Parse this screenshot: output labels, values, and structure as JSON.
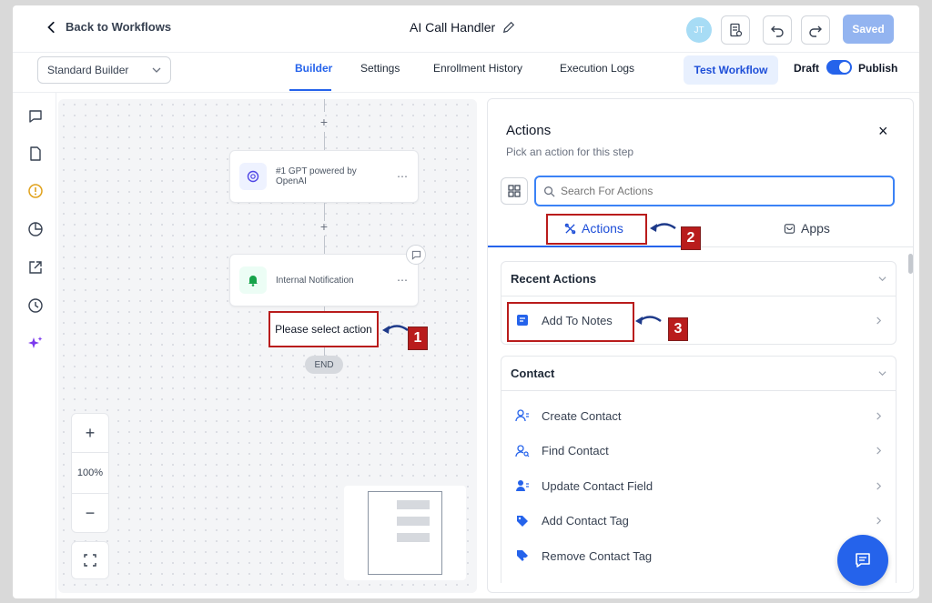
{
  "header": {
    "back_label": "Back to Workflows",
    "workflow_title": "AI Call Handler",
    "avatar_initials": "JT",
    "saved_label": "Saved"
  },
  "subbar": {
    "builder_mode": "Standard Builder",
    "tabs": [
      {
        "label": "Builder",
        "active": true
      },
      {
        "label": "Settings",
        "active": false
      },
      {
        "label": "Enrollment History",
        "active": false
      },
      {
        "label": "Execution Logs",
        "active": false
      }
    ],
    "test_label": "Test Workflow",
    "draft_label": "Draft",
    "publish_label": "Publish",
    "published": true
  },
  "canvas": {
    "nodes": [
      {
        "label": "#1 GPT powered by OpenAI",
        "icon": "openai-icon"
      },
      {
        "label": "Internal Notification",
        "icon": "bell-icon"
      }
    ],
    "select_action_label": "Please select action",
    "end_label": "END",
    "zoom_level": "100%",
    "plus_symbol": "+",
    "zoom_in_symbol": "+",
    "zoom_out_symbol": "−"
  },
  "callouts": [
    "1",
    "2",
    "3"
  ],
  "panel": {
    "title": "Actions",
    "subtitle": "Pick an action for this step",
    "close_symbol": "×",
    "search_placeholder": "Search For Actions",
    "tabs": [
      {
        "label": "Actions",
        "active": true
      },
      {
        "label": "Apps",
        "active": false
      }
    ],
    "sections": [
      {
        "title": "Recent Actions",
        "items": [
          {
            "label": "Add To Notes",
            "icon": "note-icon"
          }
        ]
      },
      {
        "title": "Contact",
        "items": [
          {
            "label": "Create Contact",
            "icon": "create-contact-icon"
          },
          {
            "label": "Find Contact",
            "icon": "find-contact-icon"
          },
          {
            "label": "Update Contact Field",
            "icon": "update-contact-icon"
          },
          {
            "label": "Add Contact Tag",
            "icon": "tag-icon"
          },
          {
            "label": "Remove Contact Tag",
            "icon": "remove-tag-icon"
          }
        ]
      }
    ]
  },
  "colors": {
    "accent": "#2563eb",
    "annotation_red": "#b91c1c",
    "canvas_bg": "#f4f5f7"
  }
}
